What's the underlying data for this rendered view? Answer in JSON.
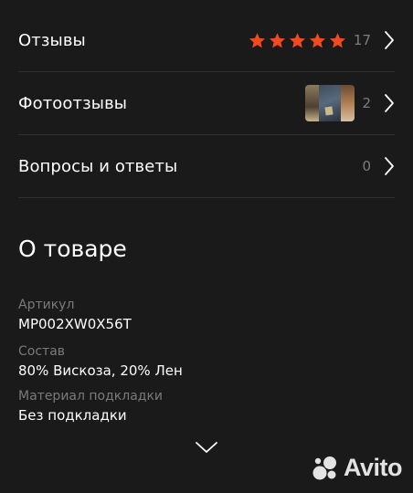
{
  "colors": {
    "background": "#1a1a1a",
    "divider": "#2f2f2f",
    "star": "#f4481e",
    "muted_text": "#7a7a7a",
    "text": "#ffffff"
  },
  "reviews": {
    "label": "Отзывы",
    "rating": 5,
    "stars_max": 5,
    "count": "17",
    "icon": "chevron-right-icon"
  },
  "photo_reviews": {
    "label": "Фотоотзывы",
    "count": "2",
    "icon": "chevron-right-icon"
  },
  "questions": {
    "label": "Вопросы и ответы",
    "count": "0",
    "icon": "chevron-right-icon"
  },
  "about": {
    "title": "О товаре",
    "specs": [
      {
        "label": "Артикул",
        "value": "MP002XW0X56T"
      },
      {
        "label": "Состав",
        "value": "80% Вискоза, 20% Лен"
      },
      {
        "label": "Материал подкладки",
        "value": "Без подкладки"
      }
    ],
    "expand_icon": "chevron-down-icon"
  },
  "watermark": {
    "text": "Avito",
    "icon": "avito-logo-icon"
  }
}
